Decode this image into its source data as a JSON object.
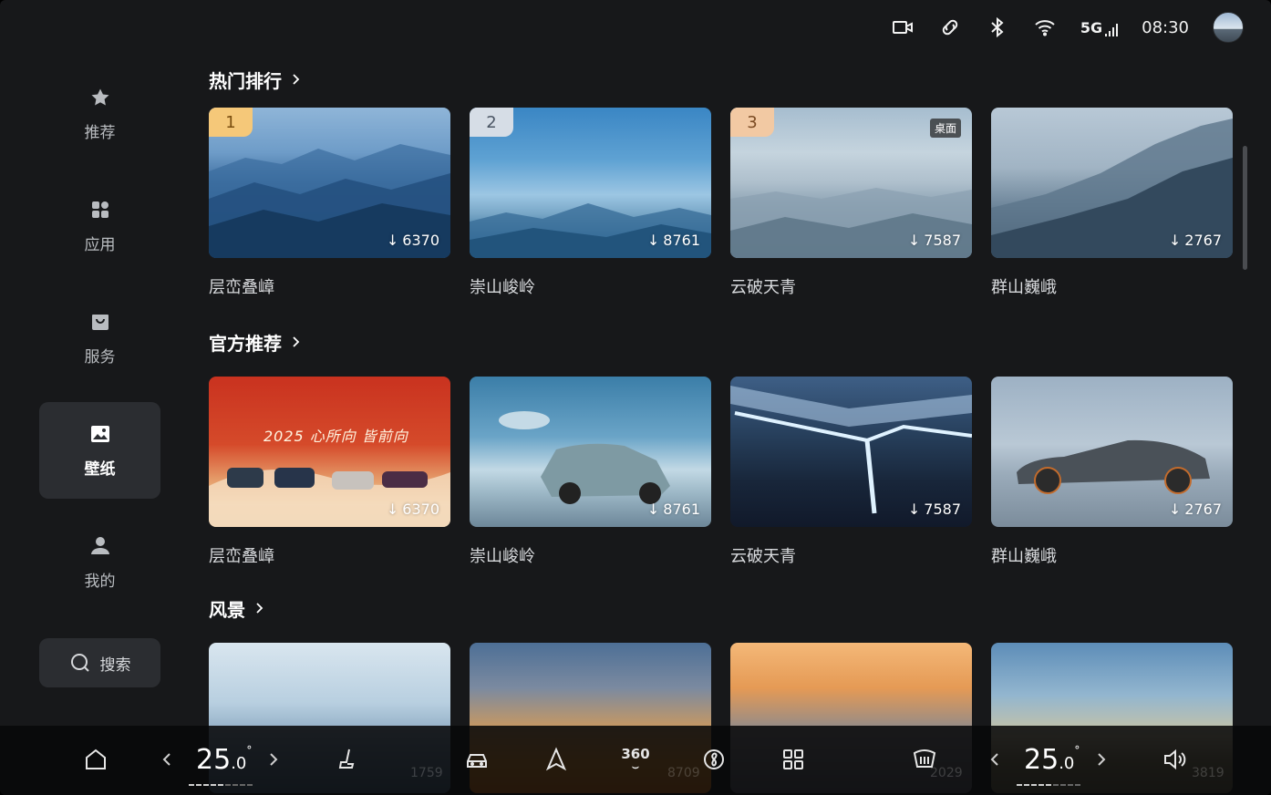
{
  "status_bar": {
    "icons": [
      "dashcam-icon",
      "link-icon",
      "bluetooth-icon",
      "wifi-icon"
    ],
    "network": "5G",
    "time": "08:30"
  },
  "sidebar": {
    "items": [
      {
        "label": "推荐",
        "icon": "star-icon"
      },
      {
        "label": "应用",
        "icon": "apps-icon"
      },
      {
        "label": "服务",
        "icon": "bag-icon"
      },
      {
        "label": "壁纸",
        "icon": "image-icon",
        "active": true
      },
      {
        "label": "我的",
        "icon": "user-icon"
      }
    ],
    "search_label": "搜索"
  },
  "sections": [
    {
      "title": "热门排行",
      "cards": [
        {
          "rank": "1",
          "title": "层峦叠嶂",
          "count": "6370"
        },
        {
          "rank": "2",
          "title": "崇山峻岭",
          "count": "8761"
        },
        {
          "rank": "3",
          "title": "云破天青",
          "count": "7587",
          "tag": "桌面"
        },
        {
          "title": "群山巍峨",
          "count": "2767"
        }
      ]
    },
    {
      "title": "官方推荐",
      "cards": [
        {
          "title": "层峦叠嶂",
          "count": "6370",
          "banner_text": "2025 心所向 皆前向"
        },
        {
          "title": "崇山峻岭",
          "count": "8761"
        },
        {
          "title": "云破天青",
          "count": "7587"
        },
        {
          "title": "群山巍峨",
          "count": "2767"
        }
      ]
    },
    {
      "title": "风景",
      "cards": [
        {
          "count": "1759"
        },
        {
          "count": "8709"
        },
        {
          "count": "2029"
        },
        {
          "count": "3819"
        }
      ]
    }
  ],
  "dock": {
    "left_temp": {
      "int": "25",
      "dec": ".0",
      "unit": "°"
    },
    "right_temp": {
      "int": "25",
      "dec": ".0",
      "unit": "°"
    },
    "icons": [
      "home-icon",
      "seat-icon",
      "car-icon",
      "navigation-icon",
      "360-icon",
      "fan-icon",
      "apps-grid-icon",
      "defrost-icon",
      "volume-icon"
    ],
    "label_360": "360"
  }
}
